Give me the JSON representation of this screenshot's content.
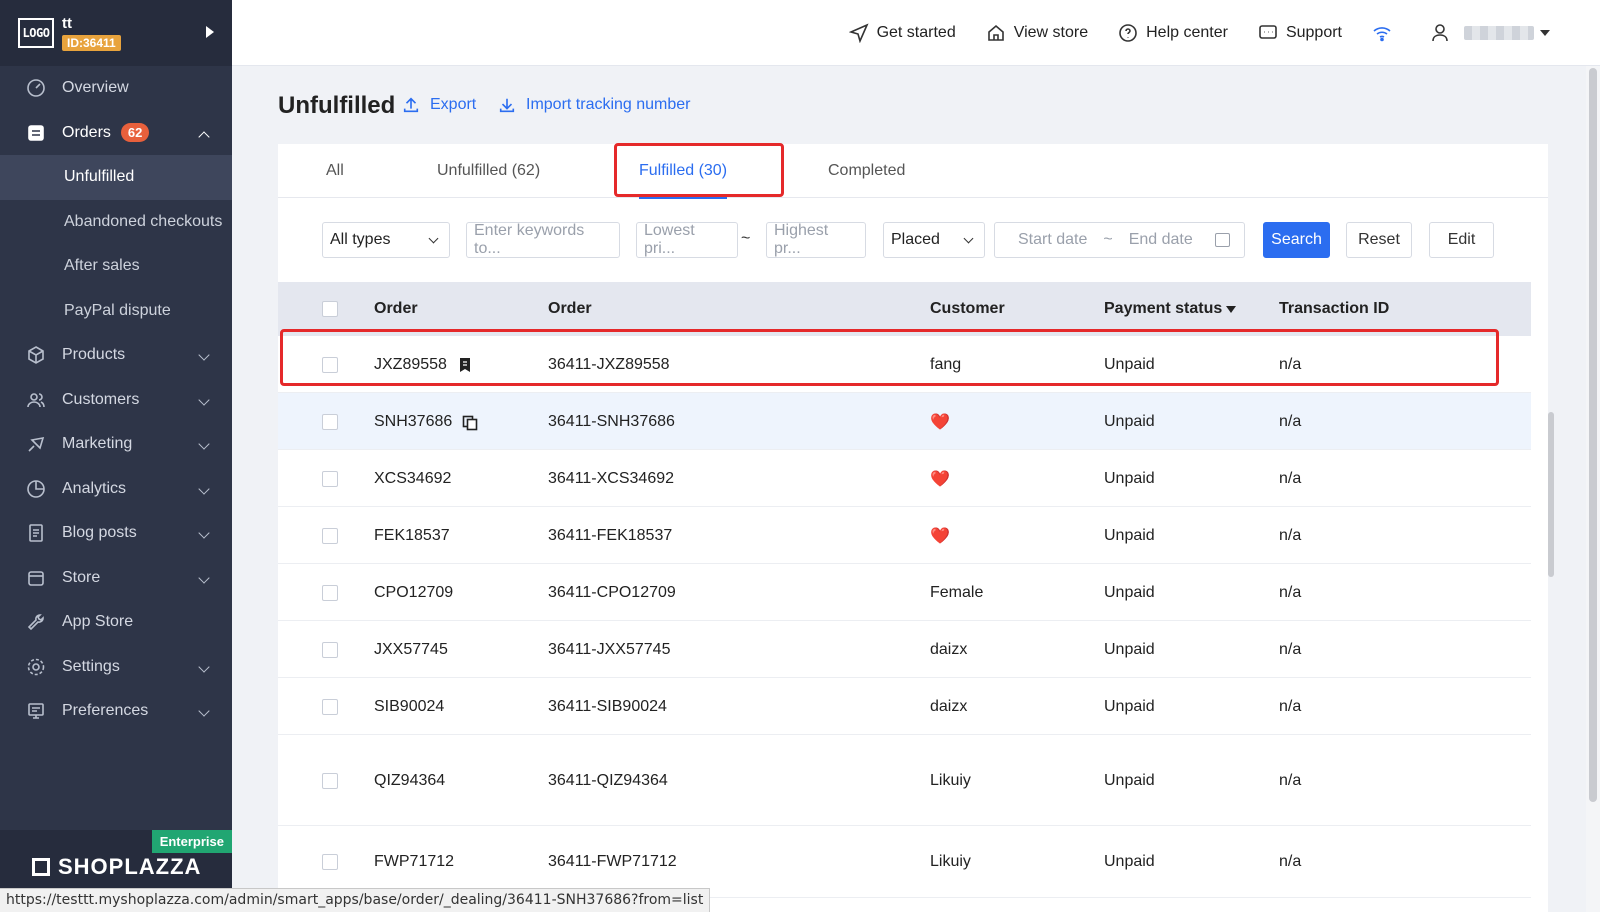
{
  "store": {
    "logo_text": "LOGO",
    "name": "tt",
    "id_badge": "ID:36411"
  },
  "sidebar": {
    "items": [
      {
        "label": "Overview",
        "icon": "gauge-icon"
      },
      {
        "label": "Orders",
        "badge": "62",
        "icon": "orders-icon"
      },
      {
        "label": "Products",
        "icon": "box-icon"
      },
      {
        "label": "Customers",
        "icon": "users-icon"
      },
      {
        "label": "Marketing",
        "icon": "megaphone-icon"
      },
      {
        "label": "Analytics",
        "icon": "pie-chart-icon"
      },
      {
        "label": "Blog posts",
        "icon": "document-icon"
      },
      {
        "label": "Store",
        "icon": "store-icon"
      },
      {
        "label": "App Store",
        "icon": "wrench-icon"
      },
      {
        "label": "Settings",
        "icon": "gear-icon"
      },
      {
        "label": "Preferences",
        "icon": "monitor-icon"
      }
    ],
    "orders_sub": [
      "Unfulfilled",
      "Abandoned checkouts",
      "After sales",
      "PayPal dispute"
    ],
    "plan_badge": "Enterprise",
    "brand": "SHOPLAZZA"
  },
  "topbar": {
    "get_started": "Get started",
    "view_store": "View store",
    "help_center": "Help center",
    "support": "Support"
  },
  "page": {
    "title": "Unfulfilled",
    "export": "Export",
    "import_tracking": "Import tracking number"
  },
  "tabs": [
    "All",
    "Unfulfilled  (62)",
    "Fulfilled  (30)",
    "Completed"
  ],
  "filters": {
    "type_value": "All types",
    "keywords_placeholder": "Enter keywords to...",
    "lowest_placeholder": "Lowest pri...",
    "price_sep": "~",
    "highest_placeholder": "Highest pr...",
    "date_type": "Placed",
    "start_date": "Start date",
    "date_sep": "~",
    "end_date": "End date",
    "search": "Search",
    "reset": "Reset",
    "edit": "Edit"
  },
  "table": {
    "columns": [
      "Order",
      "Order",
      "Customer",
      "Payment status",
      "Transaction ID"
    ],
    "rows": [
      {
        "order": "JXZ89558",
        "order_full": "36411-JXZ89558",
        "customer": "fang",
        "payment": "Unpaid",
        "txn": "n/a"
      },
      {
        "order": "SNH37686",
        "order_full": "36411-SNH37686",
        "customer": "❤️",
        "payment": "Unpaid",
        "txn": "n/a"
      },
      {
        "order": "XCS34692",
        "order_full": "36411-XCS34692",
        "customer": "❤️",
        "payment": "Unpaid",
        "txn": "n/a"
      },
      {
        "order": "FEK18537",
        "order_full": "36411-FEK18537",
        "customer": "❤️",
        "payment": "Unpaid",
        "txn": "n/a"
      },
      {
        "order": "CPO12709",
        "order_full": "36411-CPO12709",
        "customer": "Female",
        "payment": "Unpaid",
        "txn": "n/a"
      },
      {
        "order": "JXX57745",
        "order_full": "36411-JXX57745",
        "customer": "daizx",
        "payment": "Unpaid",
        "txn": "n/a"
      },
      {
        "order": "SIB90024",
        "order_full": "36411-SIB90024",
        "customer": "daizx",
        "payment": "Unpaid",
        "txn": "n/a"
      },
      {
        "order": "QIZ94364",
        "order_full": "36411-QIZ94364",
        "customer": "Likuiy",
        "payment": "Unpaid",
        "txn": "n/a"
      },
      {
        "order": "FWP71712",
        "order_full": "36411-FWP71712",
        "customer": "Likuiy",
        "payment": "Unpaid",
        "txn": "n/a"
      }
    ]
  },
  "status_url": "https://testtt.myshoplazza.com/admin/smart_apps/base/order/_dealing/36411-SNH37686?from=list",
  "colors": {
    "accent": "#2b6df0",
    "highlight": "#e5292a",
    "sidebar": "#2e3548",
    "badge": "#e8603c"
  }
}
